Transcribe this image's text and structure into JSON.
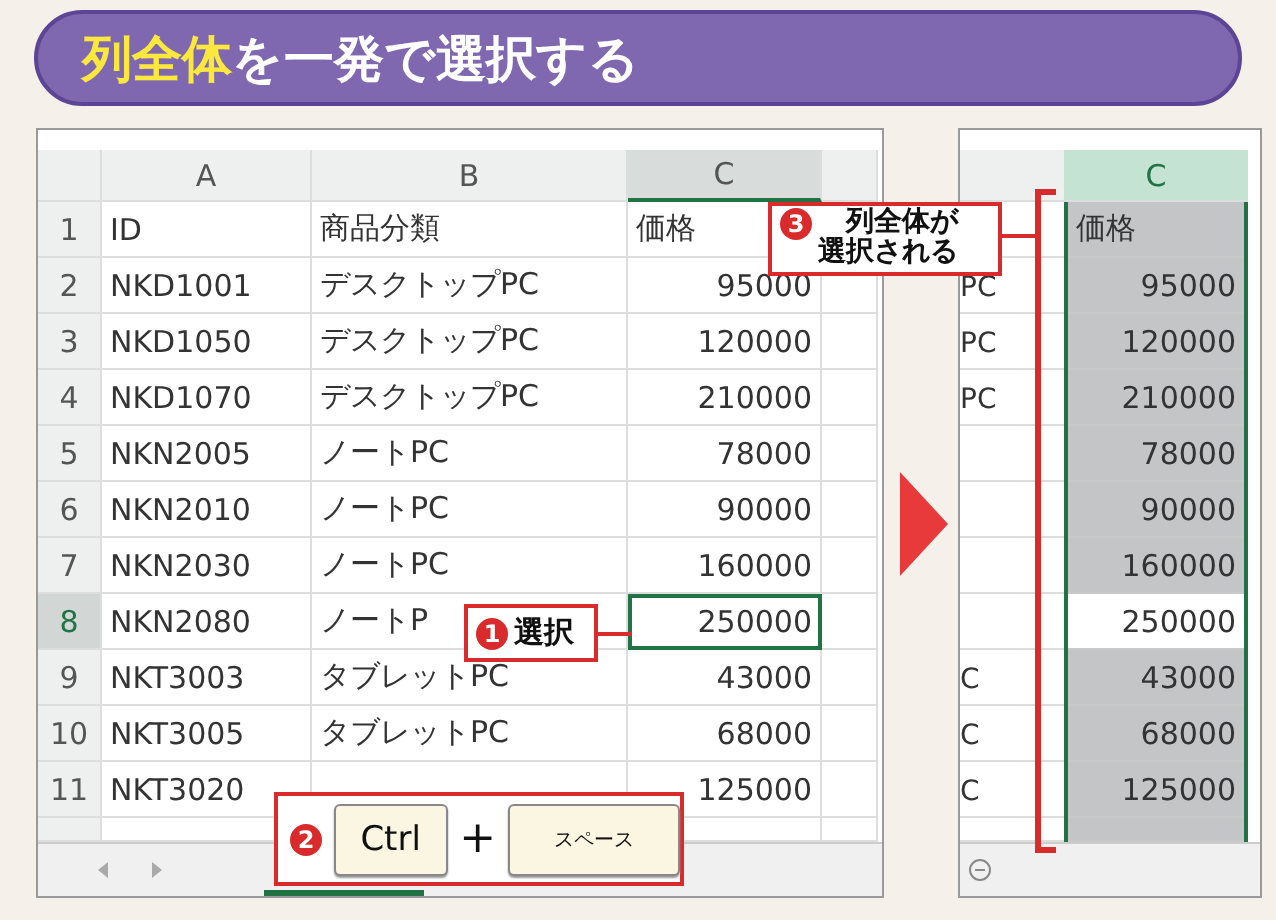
{
  "title": [
    {
      "text": "列全体",
      "highlight": true
    },
    {
      "text": "を一発で選択する",
      "highlight": false
    }
  ],
  "left_sheet": {
    "columns": [
      {
        "label": "A",
        "selected": false
      },
      {
        "label": "B",
        "selected": false
      },
      {
        "label": "C",
        "selected": true
      }
    ],
    "rows": [
      {
        "number": "1",
        "cells": [
          "ID",
          "商品分類",
          "価格"
        ],
        "active": false
      },
      {
        "number": "2",
        "cells": [
          "NKD1001",
          "デスクトップPC",
          "95000"
        ],
        "active": false
      },
      {
        "number": "3",
        "cells": [
          "NKD1050",
          "デスクトップPC",
          "120000"
        ],
        "active": false
      },
      {
        "number": "4",
        "cells": [
          "NKD1070",
          "デスクトップPC",
          "210000"
        ],
        "active": false
      },
      {
        "number": "5",
        "cells": [
          "NKN2005",
          "ノートPC",
          "78000"
        ],
        "active": false
      },
      {
        "number": "6",
        "cells": [
          "NKN2010",
          "ノートPC",
          "90000"
        ],
        "active": false
      },
      {
        "number": "7",
        "cells": [
          "NKN2030",
          "ノートPC",
          "160000"
        ],
        "active": false
      },
      {
        "number": "8",
        "cells": [
          "NKN2080",
          "ノートP",
          "250000"
        ],
        "active": true
      },
      {
        "number": "9",
        "cells": [
          "NKT3003",
          "タブレットPC",
          "43000"
        ],
        "active": false
      },
      {
        "number": "10",
        "cells": [
          "NKT3005",
          "タブレットPC",
          "68000"
        ],
        "active": false
      },
      {
        "number": "11",
        "cells": [
          "NKT3020",
          null,
          "125000"
        ],
        "active": false
      }
    ]
  },
  "right_sheet": {
    "column": {
      "label": "C",
      "selected": true
    },
    "rows": [
      {
        "value": "価格",
        "selected": true
      },
      {
        "fragment": "PC",
        "value": "95000",
        "selected": true
      },
      {
        "fragment": "PC",
        "value": "120000",
        "selected": true
      },
      {
        "fragment": "PC",
        "value": "210000",
        "selected": true
      },
      {
        "value": "78000",
        "selected": true
      },
      {
        "value": "90000",
        "selected": true
      },
      {
        "value": "160000",
        "selected": true
      },
      {
        "value": "250000",
        "selected": false
      },
      {
        "fragment": "C",
        "value": "43000",
        "selected": true
      },
      {
        "fragment": "C",
        "value": "68000",
        "selected": true
      },
      {
        "fragment": "C",
        "value": "125000",
        "selected": true
      }
    ]
  },
  "callouts": [
    {
      "number": "1",
      "lines": [
        "選択"
      ]
    },
    {
      "number": "3",
      "lines": [
        "列全体が",
        "選択される"
      ]
    }
  ],
  "shortcut": {
    "number": "2",
    "keys": [
      "Ctrl",
      "スペース"
    ],
    "joiner": "+"
  }
}
